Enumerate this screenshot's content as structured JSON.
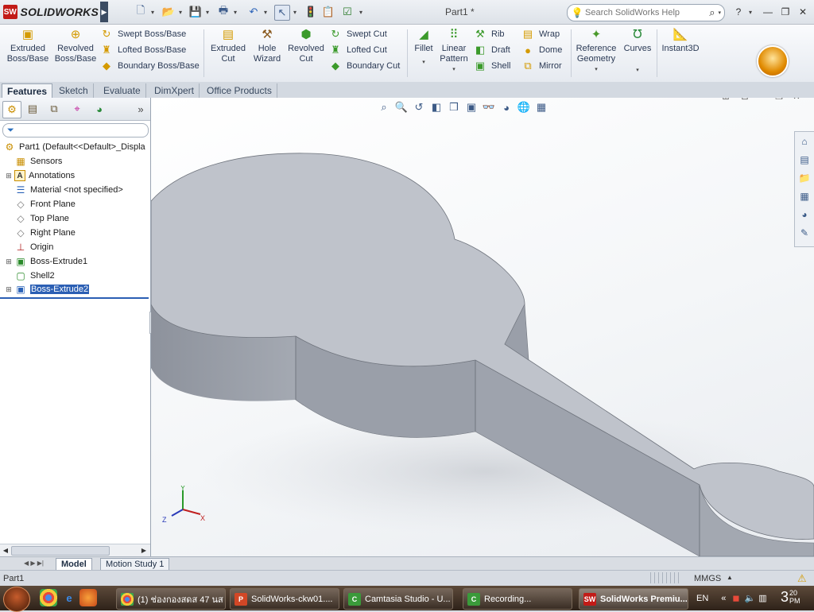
{
  "app": {
    "name": "SOLIDWORKS",
    "document_title": "Part1 *",
    "search_placeholder": "Search SolidWorks Help"
  },
  "quick_access": {
    "icons": [
      "new-document-icon",
      "open-icon",
      "save-icon",
      "print-icon",
      "undo-icon",
      "select-icon",
      "rebuild-icon",
      "options-icon"
    ]
  },
  "command_manager": {
    "big_tools": [
      {
        "label": "Extruded Boss/Base",
        "icon": "extruded-boss-icon"
      },
      {
        "label": "Revolved Boss/Base",
        "icon": "revolved-boss-icon"
      }
    ],
    "boss_group": [
      "Swept Boss/Base",
      "Lofted Boss/Base",
      "Boundary Boss/Base"
    ],
    "cut_tools": [
      {
        "label": "Extruded Cut",
        "icon": "extruded-cut-icon"
      },
      {
        "label": "Hole Wizard",
        "icon": "hole-wizard-icon"
      },
      {
        "label": "Revolved Cut",
        "icon": "revolved-cut-icon"
      }
    ],
    "cut_group": [
      "Swept Cut",
      "Lofted Cut",
      "Boundary Cut"
    ],
    "fillet": "Fillet",
    "linear_pattern": "Linear Pattern",
    "features_col1": [
      "Rib",
      "Draft",
      "Shell"
    ],
    "features_col2": [
      "Wrap",
      "Dome",
      "Mirror"
    ],
    "reference_geometry": "Reference Geometry",
    "curves": "Curves",
    "instant3d": "Instant3D"
  },
  "tabs": [
    "Features",
    "Sketch",
    "Evaluate",
    "DimXpert",
    "Office Products"
  ],
  "feature_tree": {
    "root": "Part1  (Default<<Default>_Displa",
    "items": [
      {
        "label": "Sensors",
        "icon": "sensors-icon",
        "expandable": false
      },
      {
        "label": "Annotations",
        "icon": "annotations-icon",
        "expandable": true
      },
      {
        "label": "Material <not specified>",
        "icon": "material-icon",
        "expandable": false
      },
      {
        "label": "Front Plane",
        "icon": "plane-icon",
        "expandable": false
      },
      {
        "label": "Top Plane",
        "icon": "plane-icon",
        "expandable": false
      },
      {
        "label": "Right Plane",
        "icon": "plane-icon",
        "expandable": false
      },
      {
        "label": "Origin",
        "icon": "origin-icon",
        "expandable": false
      },
      {
        "label": "Boss-Extrude1",
        "icon": "boss-extrude-icon",
        "expandable": true
      },
      {
        "label": "Shell2",
        "icon": "shell-icon",
        "expandable": false
      },
      {
        "label": "Boss-Extrude2",
        "icon": "boss-extrude-icon",
        "expandable": true,
        "selected": true
      }
    ]
  },
  "triad": {
    "x": "X",
    "y": "Y",
    "z": "Z"
  },
  "bottom_tabs": [
    "Model",
    "Motion Study 1"
  ],
  "status": {
    "left": "Part1",
    "units": "MMGS"
  },
  "taskbar": {
    "tasks": [
      {
        "label": "(1) ช่องกองสดส 47 นส ...",
        "icon": "chrome-icon",
        "active": false
      },
      {
        "label": "SolidWorks-ckw01....",
        "icon": "powerpoint-icon",
        "active": false
      },
      {
        "label": "Camtasia Studio - U...",
        "icon": "camtasia-icon",
        "active": false
      },
      {
        "label": "Recording...",
        "icon": "camtasia-icon",
        "active": false
      },
      {
        "label": "SolidWorks Premiu...",
        "icon": "solidworks-icon",
        "active": true
      }
    ],
    "language": "EN",
    "clock_hour": "3",
    "clock_minutes": "20",
    "clock_ampm": "PM"
  },
  "colors": {
    "model_top": "#bfc3cb",
    "model_side": "#9a9fa9",
    "selection": "#2b5fb4",
    "brand_red": "#c21b17"
  }
}
